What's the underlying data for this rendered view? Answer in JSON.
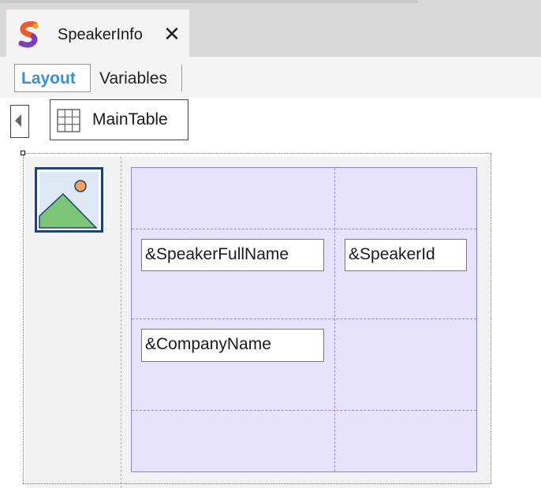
{
  "document_tab": {
    "title": "SpeakerInfo",
    "close_glyph": "✕",
    "logo_icon": "genexus-logo-icon"
  },
  "view_tabs": {
    "layout_label": "Layout",
    "variables_label": "Variables",
    "active": "Layout"
  },
  "breadcrumb": {
    "collapse_icon": "chevron-left-icon",
    "table_icon": "grid-table-icon",
    "table_label": "MainTable"
  },
  "canvas": {
    "image_icon": "image-placeholder-icon",
    "fields": {
      "speaker_full_name": "&SpeakerFullName",
      "speaker_id": "&SpeakerId",
      "company_name": "&CompanyName"
    }
  },
  "colors": {
    "active_tab_text": "#3a8fdc",
    "table_fill": "#e6e3fb",
    "table_border": "#8c8ad4"
  }
}
